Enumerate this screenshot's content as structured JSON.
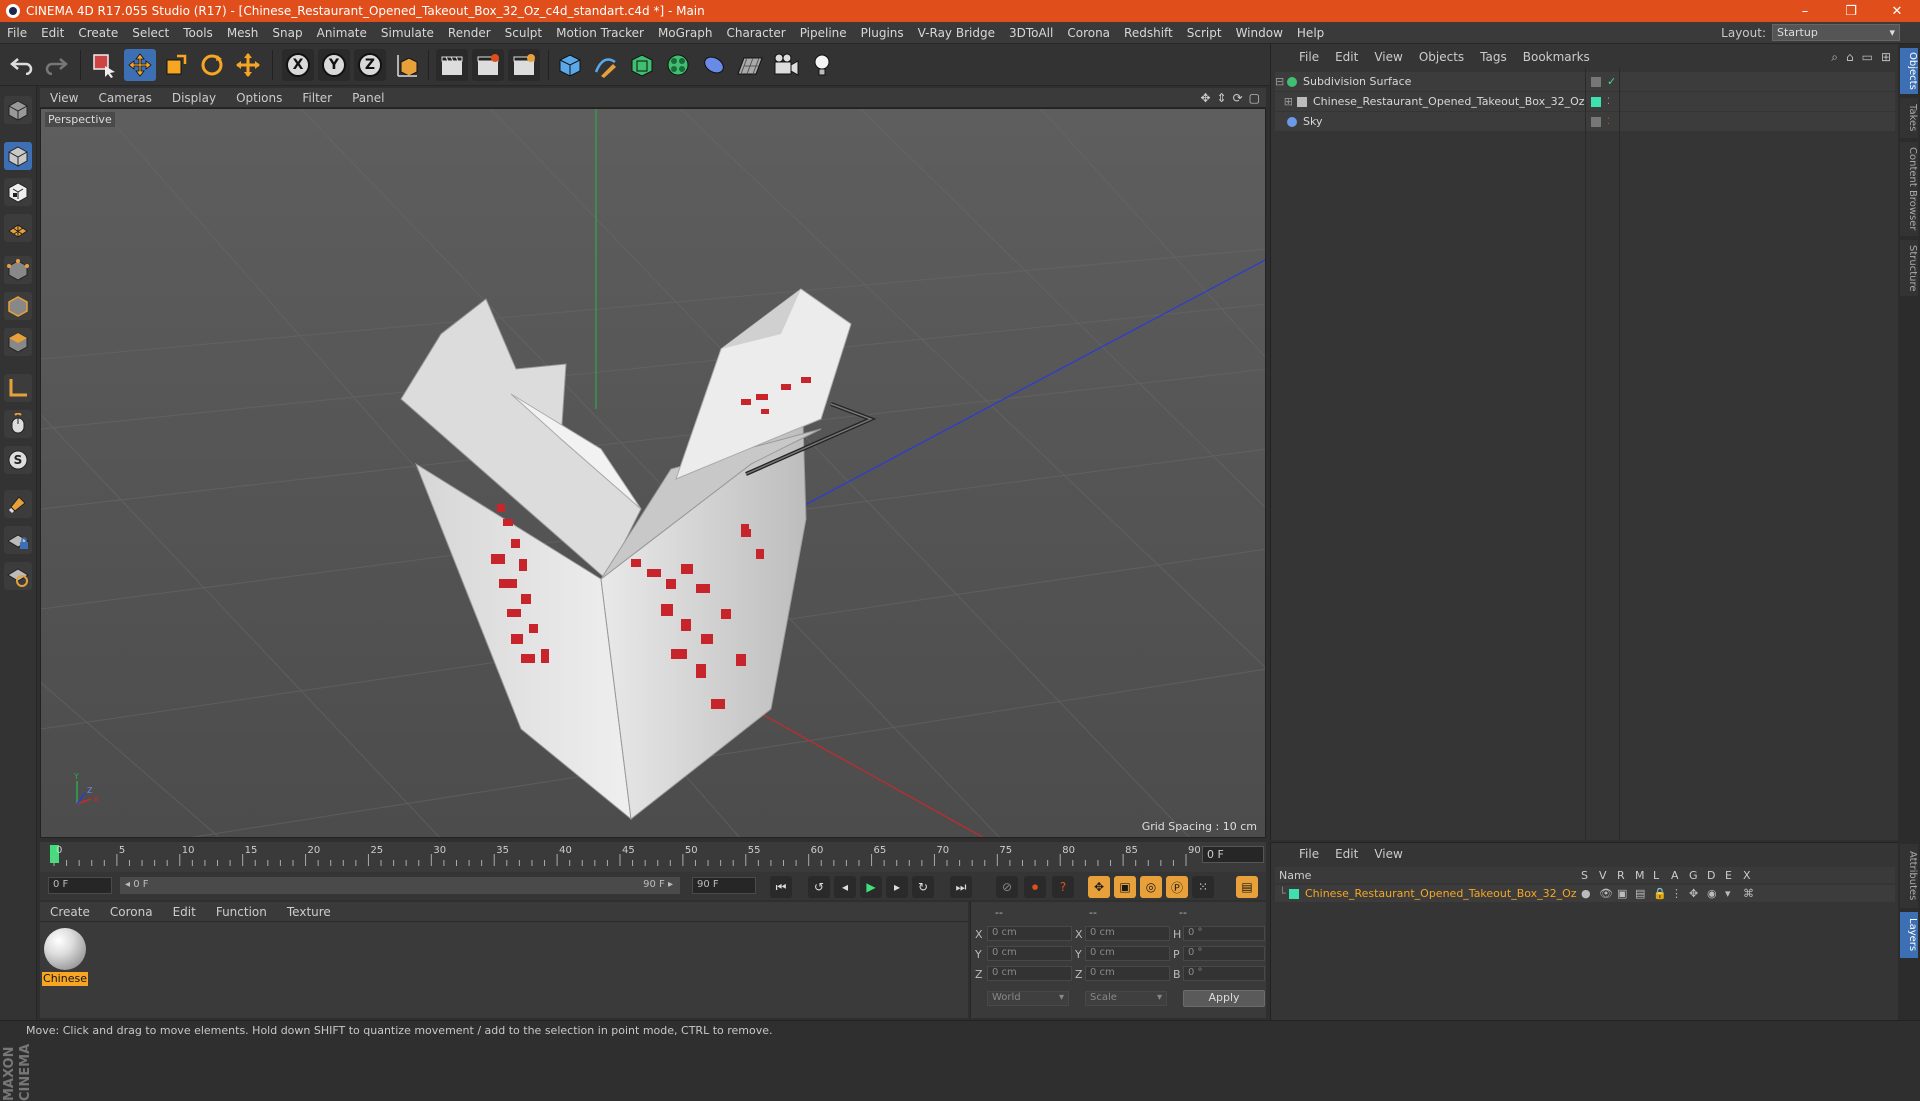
{
  "window": {
    "title": "CINEMA 4D R17.055 Studio (R17) - [Chinese_Restaurant_Opened_Takeout_Box_32_Oz_c4d_standart.c4d *] - Main",
    "minimize": "–",
    "restore": "❐",
    "close": "✕"
  },
  "menubar": {
    "items": [
      "File",
      "Edit",
      "Create",
      "Select",
      "Tools",
      "Mesh",
      "Snap",
      "Animate",
      "Simulate",
      "Render",
      "Sculpt",
      "Motion Tracker",
      "MoGraph",
      "Character",
      "Pipeline",
      "Plugins",
      "V-Ray Bridge",
      "3DToAll",
      "Corona",
      "Redshift",
      "Script",
      "Window",
      "Help"
    ],
    "layout_label": "Layout:",
    "layout_value": "Startup"
  },
  "toolbar": {
    "x_label": "X",
    "y_label": "Y",
    "z_label": "Z"
  },
  "viewport": {
    "menu": [
      "View",
      "Cameras",
      "Display",
      "Options",
      "Filter",
      "Panel"
    ],
    "label": "Perspective",
    "grid_spacing": "Grid Spacing : 10 cm",
    "axis_x": "X",
    "axis_y": "Y",
    "axis_z": "Z"
  },
  "timeline": {
    "ticks": [
      "0",
      "5",
      "10",
      "15",
      "20",
      "25",
      "30",
      "35",
      "40",
      "45",
      "50",
      "55",
      "60",
      "65",
      "70",
      "75",
      "80",
      "85",
      "90"
    ],
    "current_frame": "0 F",
    "start_field": "0 F",
    "range_start": "◂ 0 F",
    "range_end": "90 F ▸",
    "end_field": "90 F"
  },
  "materials": {
    "menu": [
      "Create",
      "Corona",
      "Edit",
      "Function",
      "Texture"
    ],
    "items": [
      {
        "name": "Chinese"
      }
    ]
  },
  "coordinates": {
    "header": [
      "--",
      "--",
      "--"
    ],
    "rows": [
      {
        "a": "X",
        "av": "0 cm",
        "b": "X",
        "bv": "0 cm",
        "c": "H",
        "cv": "0 °"
      },
      {
        "a": "Y",
        "av": "0 cm",
        "b": "Y",
        "bv": "0 cm",
        "c": "P",
        "cv": "0 °"
      },
      {
        "a": "Z",
        "av": "0 cm",
        "b": "Z",
        "bv": "0 cm",
        "c": "B",
        "cv": "0 °"
      }
    ],
    "world": "World",
    "scale": "Scale",
    "apply": "Apply"
  },
  "objects": {
    "menu": [
      "File",
      "Edit",
      "View",
      "Objects",
      "Tags",
      "Bookmarks"
    ],
    "items": [
      {
        "name": "Subdivision Surface"
      },
      {
        "name": "Chinese_Restaurant_Opened_Takeout_Box_32_Oz"
      },
      {
        "name": "Sky"
      }
    ]
  },
  "layers": {
    "menu": [
      "File",
      "Edit",
      "View"
    ],
    "columns": [
      "Name",
      "S",
      "V",
      "R",
      "M",
      "L",
      "A",
      "G",
      "D",
      "E",
      "X"
    ],
    "items": [
      {
        "name": "Chinese_Restaurant_Opened_Takeout_Box_32_Oz"
      }
    ]
  },
  "right_tabs": [
    "Objects",
    "Takes",
    "Content Browser",
    "Structure",
    "Attributes",
    "Layers"
  ],
  "status": "Move: Click and drag to move elements. Hold down SHIFT to quantize movement / add to the selection in point mode, CTRL to remove.",
  "branding": "MAXON CINEMA 4D",
  "colors": {
    "titlebar": "#e04e1c",
    "accent_blue": "#3d6fb4",
    "selection_orange": "#f6a623",
    "layer_green": "#3fe0b0"
  }
}
